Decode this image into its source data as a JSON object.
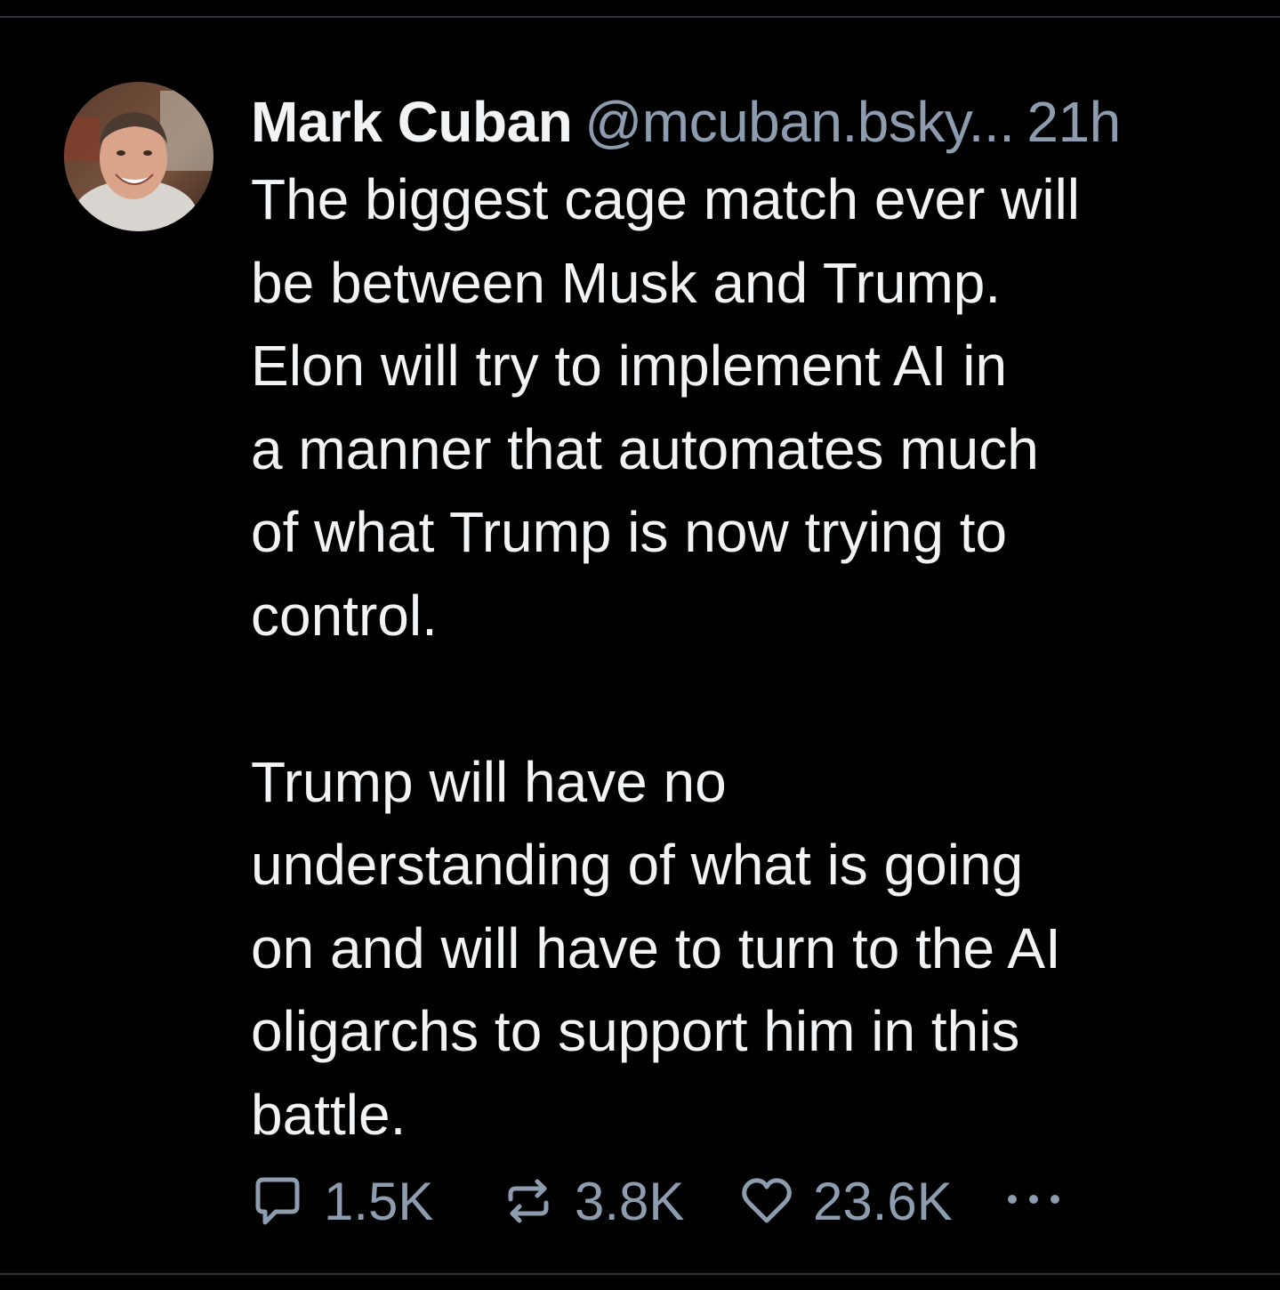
{
  "post": {
    "author": {
      "display_name": "Mark Cuban",
      "handle": "@mcuban.bsky...",
      "avatar_icon": "profile-photo"
    },
    "timestamp": "21h",
    "text": "The biggest cage match ever will\nbe between Musk and Trump.\nElon will try to implement AI in\na manner that automates much\nof what Trump is now trying to\ncontrol.\n\nTrump will have no\nunderstanding of what is going\non and will have to turn to the AI\noligarchs to support him in this\nbattle.",
    "actions": {
      "reply": {
        "icon": "reply-bubble-icon",
        "count": "1.5K"
      },
      "repost": {
        "icon": "repost-icon",
        "count": "3.8K"
      },
      "like": {
        "icon": "heart-icon",
        "count": "23.6K"
      },
      "more": {
        "icon": "more-dots-icon"
      }
    }
  },
  "colors": {
    "background": "#000000",
    "text": "#f1f3f5",
    "muted": "#8d9caf",
    "divider": "#2b323b"
  }
}
